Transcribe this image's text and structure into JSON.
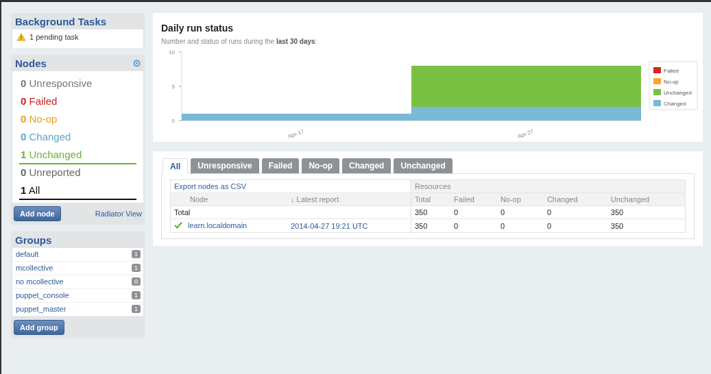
{
  "background_tasks": {
    "title": "Background Tasks",
    "message": "1 pending task"
  },
  "nodes": {
    "title": "Nodes",
    "items": [
      {
        "count": "0",
        "label": "Unresponsive",
        "color": "#777777",
        "underlined": false
      },
      {
        "count": "0",
        "label": "Failed",
        "color": "#cc2222",
        "underlined": false
      },
      {
        "count": "0",
        "label": "No-op",
        "color": "#e8a020",
        "underlined": false
      },
      {
        "count": "0",
        "label": "Changed",
        "color": "#5ba8cc",
        "underlined": false
      },
      {
        "count": "1",
        "label": "Unchanged",
        "color": "#6ab333",
        "underlined": true
      },
      {
        "count": "0",
        "label": "Unreported",
        "color": "#666666",
        "underlined": false
      },
      {
        "count": "1",
        "label": "All",
        "color": "#111111",
        "underlined": true
      }
    ],
    "add_button": "Add node",
    "radiator_link": "Radiator View"
  },
  "groups": {
    "title": "Groups",
    "items": [
      {
        "name": "default",
        "count": "1"
      },
      {
        "name": "mcollective",
        "count": "1"
      },
      {
        "name": "no mcollective",
        "count": "0"
      },
      {
        "name": "puppet_console",
        "count": "1"
      },
      {
        "name": "puppet_master",
        "count": "1"
      }
    ],
    "add_button": "Add group"
  },
  "daily_run": {
    "title": "Daily run status",
    "subtitle": "Number and status of runs during the **last 30 days**:",
    "chart_data": {
      "type": "bar",
      "stacked": true,
      "legend": true,
      "categories": [
        "Apr-17",
        "Apr-27"
      ],
      "ylim": [
        0,
        10
      ],
      "yticks": [
        0,
        5,
        10
      ],
      "series": [
        {
          "name": "Failed",
          "color": "#dd2222",
          "values": [
            0,
            0
          ]
        },
        {
          "name": "No-op",
          "color": "#f0a830",
          "values": [
            0,
            0
          ]
        },
        {
          "name": "Unchanged",
          "color": "#7ac143",
          "values": [
            0,
            6
          ]
        },
        {
          "name": "Changed",
          "color": "#79b8d6",
          "values": [
            1,
            2
          ]
        }
      ]
    }
  },
  "tabs": [
    {
      "label": "All",
      "selected": true
    },
    {
      "label": "Unresponsive",
      "selected": false
    },
    {
      "label": "Failed",
      "selected": false
    },
    {
      "label": "No-op",
      "selected": false
    },
    {
      "label": "Changed",
      "selected": false
    },
    {
      "label": "Unchanged",
      "selected": false
    }
  ],
  "table": {
    "export_link": "Export nodes as CSV",
    "group_header": "Resources",
    "columns": [
      "Node",
      "↓ Latest report",
      "Total",
      "Failed",
      "No-op",
      "Changed",
      "Unchanged"
    ],
    "rows": [
      {
        "kind": "total",
        "cells": [
          "Total",
          "",
          "350",
          "0",
          "0",
          "0",
          "350"
        ]
      },
      {
        "kind": "node",
        "cells": [
          "learn.localdomain",
          "2014-04-27 19:21 UTC",
          "350",
          "0",
          "0",
          "0",
          "350"
        ]
      }
    ]
  }
}
